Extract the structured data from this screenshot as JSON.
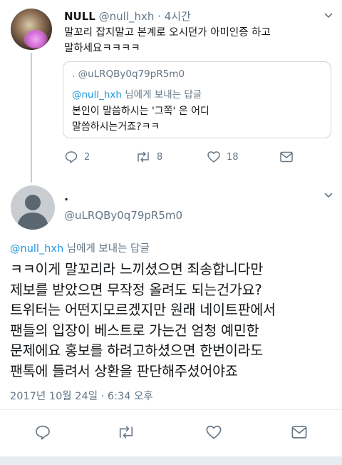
{
  "tweet1": {
    "name": "NULL",
    "handle": "@null_hxh",
    "time": "· 4시간",
    "text_line1": "말꼬리 잡지말고 본계로 오시던가 아미인증 하고",
    "text_line2": "말하세요ㅋㅋㅋㅋ",
    "quote": {
      "handle": ". @uLRQBy0q79pR5m0",
      "reply_user": "@null_hxh",
      "reply_suffix": " 님에게 보내는 답글",
      "text_line1": "본인이 말씀하시는 '그쪽' 은 어디",
      "text_line2": "말씀하시는거죠?ㅋㅋ"
    },
    "reply_count": "2",
    "retweet_count": "8",
    "like_count": "18"
  },
  "tweet2": {
    "name": ".",
    "handle": "@uLRQBy0q79pR5m0",
    "reply_user": "@null_hxh",
    "reply_suffix": " 님에게 보내는 답글",
    "lines": [
      "ㅋㅋ이게 말꼬리라 느끼셨으면 죄송합니다만",
      "제보를 받았으면 무작정 올려도 되는건가요?",
      "트위터는 어떤지모르겠지만 원래 네이트판에서",
      "팬들의 입장이 베스트로 가는건 엄청 예민한",
      "문제에요 홍보를 하려고하셨으면 한번이라도",
      "팬톡에 들려서 상환을 판단해주셨어야죠"
    ],
    "timestamp": "2017년 10월 24일 · 6:34 오후"
  },
  "colors": {
    "accent": "#1b95e0",
    "text": "#14171a",
    "muted": "#657786",
    "border": "#ccd6dd"
  },
  "icons": [
    "reply-icon",
    "retweet-icon",
    "like-icon",
    "dm-icon",
    "chevron-down-icon"
  ]
}
